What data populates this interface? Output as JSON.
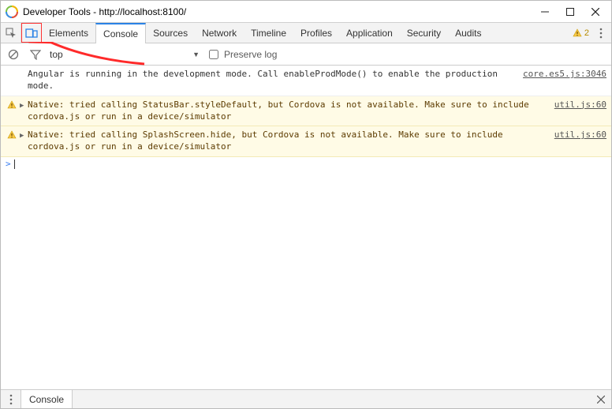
{
  "window": {
    "title": "Developer Tools - http://localhost:8100/"
  },
  "tabs": {
    "elements": "Elements",
    "console": "Console",
    "sources": "Sources",
    "network": "Network",
    "timeline": "Timeline",
    "profiles": "Profiles",
    "application": "Application",
    "security": "Security",
    "audits": "Audits"
  },
  "warn_count": "2",
  "filter": {
    "context": "top",
    "preserve_label": "Preserve log"
  },
  "logs": [
    {
      "level": "log",
      "text": "Angular is running in the development mode. Call enableProdMode() to enable the production mode.",
      "source": "core.es5.js:3046"
    },
    {
      "level": "warn",
      "text": "Native: tried calling StatusBar.styleDefault, but Cordova is not available. Make sure to include cordova.js or run in a device/simulator",
      "source": "util.js:60"
    },
    {
      "level": "warn",
      "text": "Native: tried calling SplashScreen.hide, but Cordova is not available. Make sure to include cordova.js or run in a device/simulator",
      "source": "util.js:60"
    }
  ],
  "drawer": {
    "tab": "Console"
  }
}
